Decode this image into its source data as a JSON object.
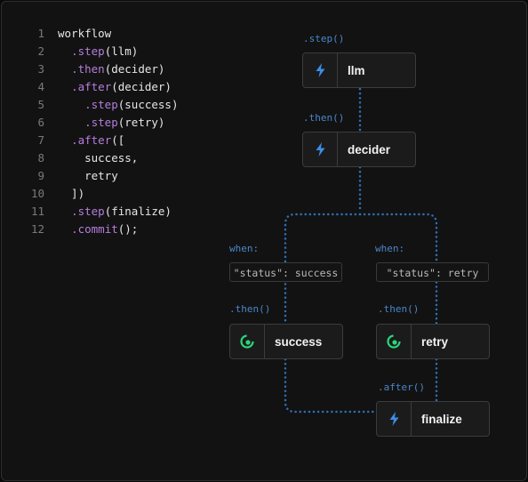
{
  "code": [
    {
      "n": "1",
      "parts": [
        {
          "t": "workflow",
          "k": false
        }
      ]
    },
    {
      "n": "2",
      "parts": [
        {
          "t": "  ",
          "k": false
        },
        {
          "t": ".step",
          "k": true
        },
        {
          "t": "(llm)",
          "k": false
        }
      ]
    },
    {
      "n": "3",
      "parts": [
        {
          "t": "  ",
          "k": false
        },
        {
          "t": ".then",
          "k": true
        },
        {
          "t": "(decider)",
          "k": false
        }
      ]
    },
    {
      "n": "4",
      "parts": [
        {
          "t": "  ",
          "k": false
        },
        {
          "t": ".after",
          "k": true
        },
        {
          "t": "(decider)",
          "k": false
        }
      ]
    },
    {
      "n": "5",
      "parts": [
        {
          "t": "    ",
          "k": false
        },
        {
          "t": ".step",
          "k": true
        },
        {
          "t": "(success)",
          "k": false
        }
      ]
    },
    {
      "n": "6",
      "parts": [
        {
          "t": "    ",
          "k": false
        },
        {
          "t": ".step",
          "k": true
        },
        {
          "t": "(retry)",
          "k": false
        }
      ]
    },
    {
      "n": "7",
      "parts": [
        {
          "t": "  ",
          "k": false
        },
        {
          "t": ".after",
          "k": true
        },
        {
          "t": "([",
          "k": false
        }
      ]
    },
    {
      "n": "8",
      "parts": [
        {
          "t": "    success,",
          "k": false
        }
      ]
    },
    {
      "n": "9",
      "parts": [
        {
          "t": "    retry",
          "k": false
        }
      ]
    },
    {
      "n": "10",
      "parts": [
        {
          "t": "  ])",
          "k": false
        }
      ]
    },
    {
      "n": "11",
      "parts": [
        {
          "t": "  ",
          "k": false
        },
        {
          "t": ".step",
          "k": true
        },
        {
          "t": "(finalize)",
          "k": false
        }
      ]
    },
    {
      "n": "12",
      "parts": [
        {
          "t": "  ",
          "k": false
        },
        {
          "t": ".commit",
          "k": true
        },
        {
          "t": "();",
          "k": false
        }
      ]
    }
  ],
  "labels": {
    "step": ".step()",
    "then_decider": ".then()",
    "when_left": "when:",
    "when_right": "when:",
    "then_success": ".then()",
    "then_retry": ".then()",
    "after_finalize": ".after()"
  },
  "conditions": {
    "success": "\"status\": success",
    "retry": "\"status\": retry"
  },
  "nodes": {
    "llm": {
      "label": "llm",
      "icon": "lightning-icon"
    },
    "decider": {
      "label": "decider",
      "icon": "lightning-icon"
    },
    "success": {
      "label": "success",
      "icon": "spiral-icon"
    },
    "retry": {
      "label": "retry",
      "icon": "spiral-icon"
    },
    "finalize": {
      "label": "finalize",
      "icon": "lightning-icon"
    }
  },
  "colors": {
    "keyword": "#b57edc",
    "connector": "#2f6fb3",
    "lightning": "#3b8ee6",
    "spiral": "#2bd67b"
  }
}
